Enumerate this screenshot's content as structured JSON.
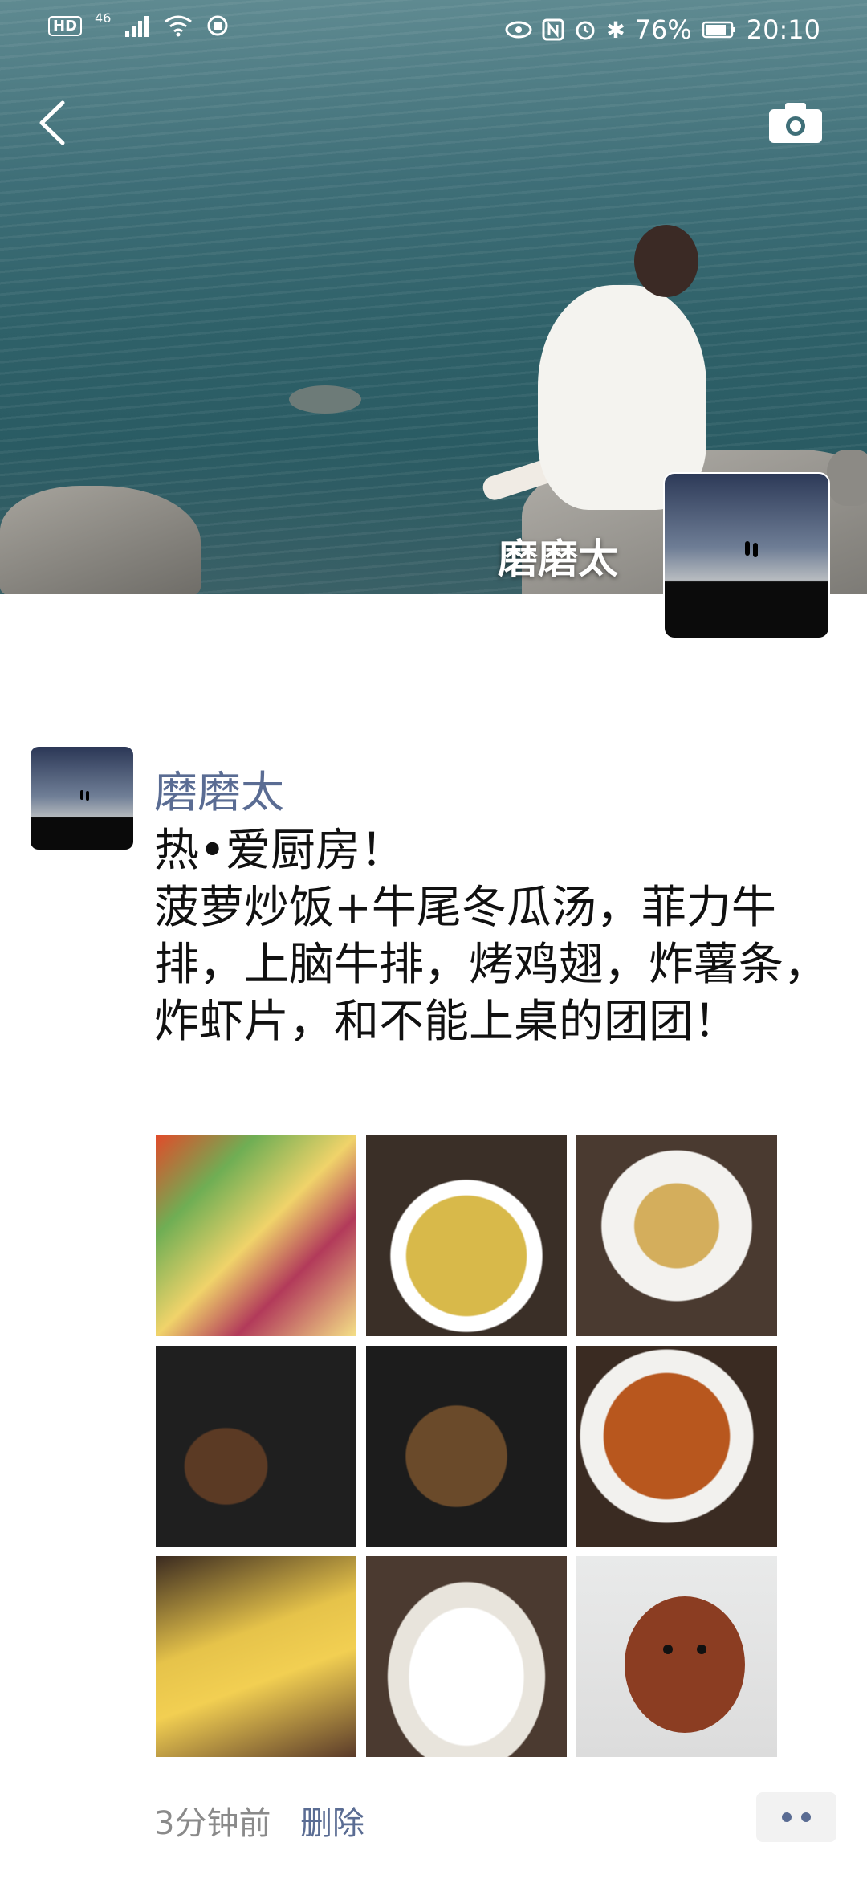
{
  "status_bar": {
    "hd": "HD",
    "network": "46",
    "battery": "76%",
    "time": "20:10",
    "icons_left": [
      "hd-badge",
      "signal-icon",
      "wifi-icon",
      "hotspot-icon"
    ],
    "icons_right": [
      "eye-icon",
      "nfc-icon",
      "alarm-icon",
      "bluetooth-icon",
      "battery-icon"
    ]
  },
  "cover": {
    "name": "磨磨太",
    "back_icon": "back-chevron-icon",
    "camera_icon": "camera-icon"
  },
  "post": {
    "author": "磨磨太",
    "text": "热•爱厨房！\n菠萝炒饭+牛尾冬瓜汤，菲力牛排，上脑牛排，烤鸡翅，炸薯条，炸虾片，和不能上桌的团团！",
    "photos": [
      "ingredients-photo",
      "pineapple-fried-rice-photo",
      "fried-rice-plate-photo",
      "filet-steak-photo",
      "ribeye-steak-photo",
      "roast-chicken-wings-photo",
      "french-fries-photo",
      "shrimp-chips-photo",
      "puppy-photo"
    ],
    "time": "3分钟前",
    "delete_label": "删除"
  },
  "colors": {
    "name_blue": "#5a6c93",
    "text": "#111111",
    "time_gray": "#8a8a8a"
  }
}
